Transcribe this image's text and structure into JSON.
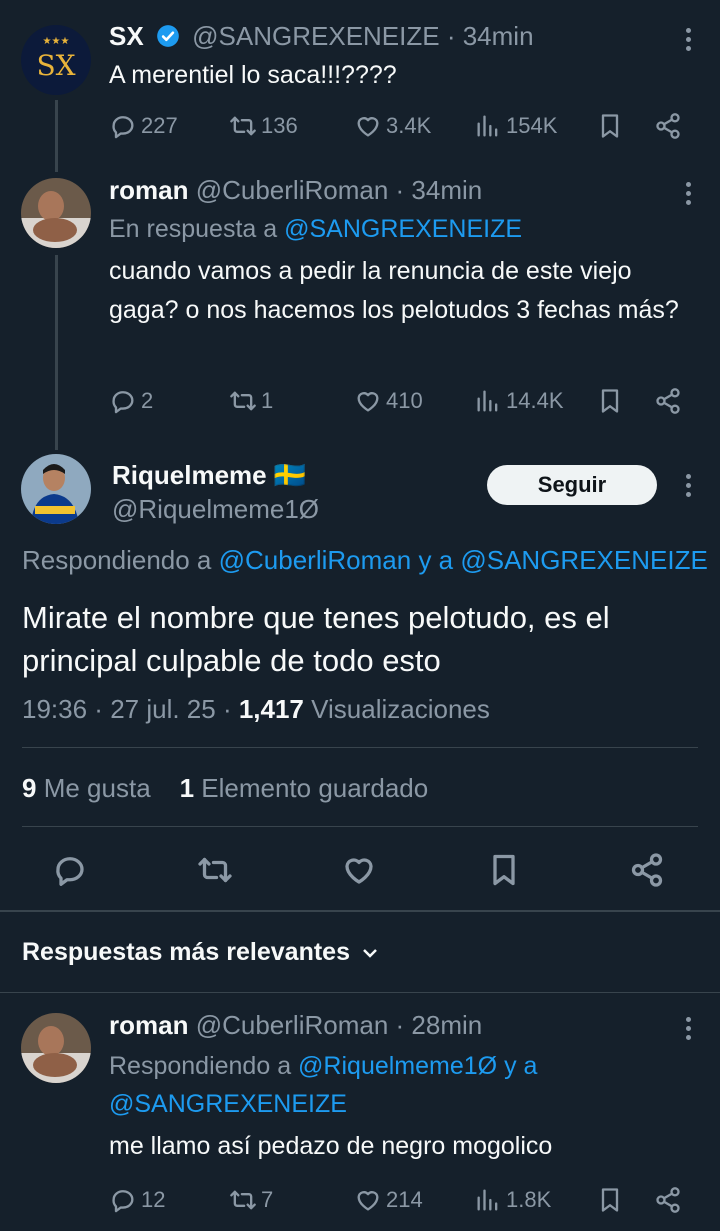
{
  "colors": {
    "background": "#15202b",
    "accent": "#1d9bf0",
    "muted": "#8b98a5",
    "text": "#f7f9f9"
  },
  "thread": [
    {
      "name": "SX",
      "verified": true,
      "handle": "@SANGREXENEIZE",
      "time": "· 34min",
      "avatar_text": "SX",
      "avatar_stars": "★★★",
      "replying_prefix": "",
      "replying_to": "",
      "text": "A merentiel lo saca!!!????",
      "stats": {
        "replies": "227",
        "retweets": "136",
        "likes": "3.4K",
        "views": "154K"
      }
    },
    {
      "name": "roman",
      "verified": false,
      "handle": "@CuberliRoman",
      "time": "· 34min",
      "replying_prefix": "En respuesta a",
      "replying_to": "@SANGREXENEIZE",
      "text": "cuando vamos a pedir la renuncia de este viejo gaga?  o nos hacemos los pelotudos 3 fechas más?",
      "stats": {
        "replies": "2",
        "retweets": "1",
        "likes": "410",
        "views": "14.4K"
      }
    }
  ],
  "main_tweet": {
    "name": "Riquelmeme",
    "flag": "🇸🇪",
    "handle": "@Riquelmeme1Ø",
    "follow_label": "Seguir",
    "replying_prefix": "Respondiendo a",
    "replying_user1": "@CuberliRoman",
    "replying_conj": "y a",
    "replying_user2": "@SANGREXENEIZE",
    "text": "Mirate el nombre que tenes pelotudo, es el principal culpable de todo esto",
    "time": "19:36",
    "date": "27 jul. 25",
    "views_count": "1,417",
    "views_label": "Visualizaciones",
    "likes_count": "9",
    "likes_label": "Me gusta",
    "saved_count": "1",
    "saved_label": "Elemento guardado"
  },
  "replies_section": {
    "sort_label": "Respuestas más relevantes"
  },
  "replies": [
    {
      "name": "roman",
      "handle": "@CuberliRoman",
      "time": "· 28min",
      "replying_prefix": "Respondiendo a",
      "replying_user1": "@Riquelmeme1Ø",
      "replying_conj": "y a",
      "replying_user2": "@SANGREXENEIZE",
      "text": "me llamo así pedazo de negro mogolico",
      "stats": {
        "replies": "12",
        "retweets": "7",
        "likes": "214",
        "views": "1.8K"
      }
    }
  ]
}
